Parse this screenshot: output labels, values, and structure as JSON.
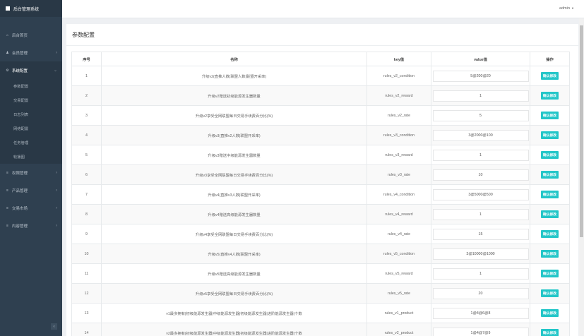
{
  "app": {
    "title": "后台管理系统"
  },
  "header": {
    "user": "admin"
  },
  "sidebar": {
    "items": [
      {
        "label": "后台首页",
        "icon": "home-icon",
        "glyph": "⌂"
      },
      {
        "label": "会员管理",
        "icon": "user-icon",
        "glyph": "♟"
      },
      {
        "label": "系统配置",
        "icon": "gears-icon",
        "glyph": "⚙"
      },
      {
        "label": "权限管理",
        "icon": "list-icon",
        "glyph": "≡"
      },
      {
        "label": "产品管理",
        "icon": "list-icon",
        "glyph": "≡"
      },
      {
        "label": "交易市场",
        "icon": "list-icon",
        "glyph": "≡"
      },
      {
        "label": "内容管理",
        "icon": "list-icon",
        "glyph": "≡"
      }
    ],
    "submenu": [
      "参数配置",
      "交易配置",
      "日志列表",
      "网络配置",
      "任务管理",
      "轮播图"
    ]
  },
  "page": {
    "title": "参数配置"
  },
  "table": {
    "headers": [
      "序号",
      "名称",
      "key值",
      "value值",
      "操作"
    ],
    "button_label": "确认修改",
    "rows": [
      {
        "no": "1",
        "name": "升级v2(直推人数|联盟人数|联盟开采率)",
        "key": "rules_v2_condition",
        "value": "5@200@20"
      },
      {
        "no": "2",
        "name": "升级v2赠送初级能源发生器数量",
        "key": "rules_v2_reward",
        "value": "1"
      },
      {
        "no": "3",
        "name": "升级v2享受全网联盟每日交易手续费百分比(%)",
        "key": "rules_v2_rate",
        "value": "5"
      },
      {
        "no": "4",
        "name": "升级v3(直推v2人数|联盟开采率)",
        "key": "rules_v3_condition",
        "value": "3@2000@100"
      },
      {
        "no": "5",
        "name": "升级v3赠送中级能源发生器数量",
        "key": "rules_v3_reward",
        "value": "1"
      },
      {
        "no": "6",
        "name": "升级v3享受全网联盟每日交易手续费百分比(%)",
        "key": "rules_v3_rate",
        "value": "10"
      },
      {
        "no": "7",
        "name": "升级v4(直推v3人数|联盟开采率)",
        "key": "rules_v4_condition",
        "value": "3@5000@500"
      },
      {
        "no": "8",
        "name": "升级v4赠送高级能源发生器数量",
        "key": "rules_v4_reward",
        "value": "1"
      },
      {
        "no": "9",
        "name": "升级v4享受全网联盟每日交易手续费百分比(%)",
        "key": "rules_v4_rate",
        "value": "15"
      },
      {
        "no": "10",
        "name": "升级v5(直推v4人数|联盟开采率)",
        "key": "rules_v5_condition",
        "value": "3@10000@1000"
      },
      {
        "no": "11",
        "name": "升级v5赠送高级能源发生器数量",
        "key": "rules_v5_reward",
        "value": "1"
      },
      {
        "no": "12",
        "name": "升级v5享受全网联盟每日交易手续费百分比(%)",
        "key": "rules_v5_rate",
        "value": "20"
      },
      {
        "no": "13",
        "name": "v1最多拥有|初级能源发生器|中级能源发生器|初级能源发生器|进阶能源发生器|个数",
        "key": "rules_v1_product",
        "value": "1@4@6@8"
      },
      {
        "no": "14",
        "name": "v2最多拥有|初级能源发生器|中级能源发生器|初级能源发生器|进阶能源发生器|个数",
        "key": "rules_v2_product",
        "value": "1@4@7@9"
      }
    ]
  },
  "colors": {
    "sidebar": "#2f4050",
    "accent": "#23c6c8"
  }
}
